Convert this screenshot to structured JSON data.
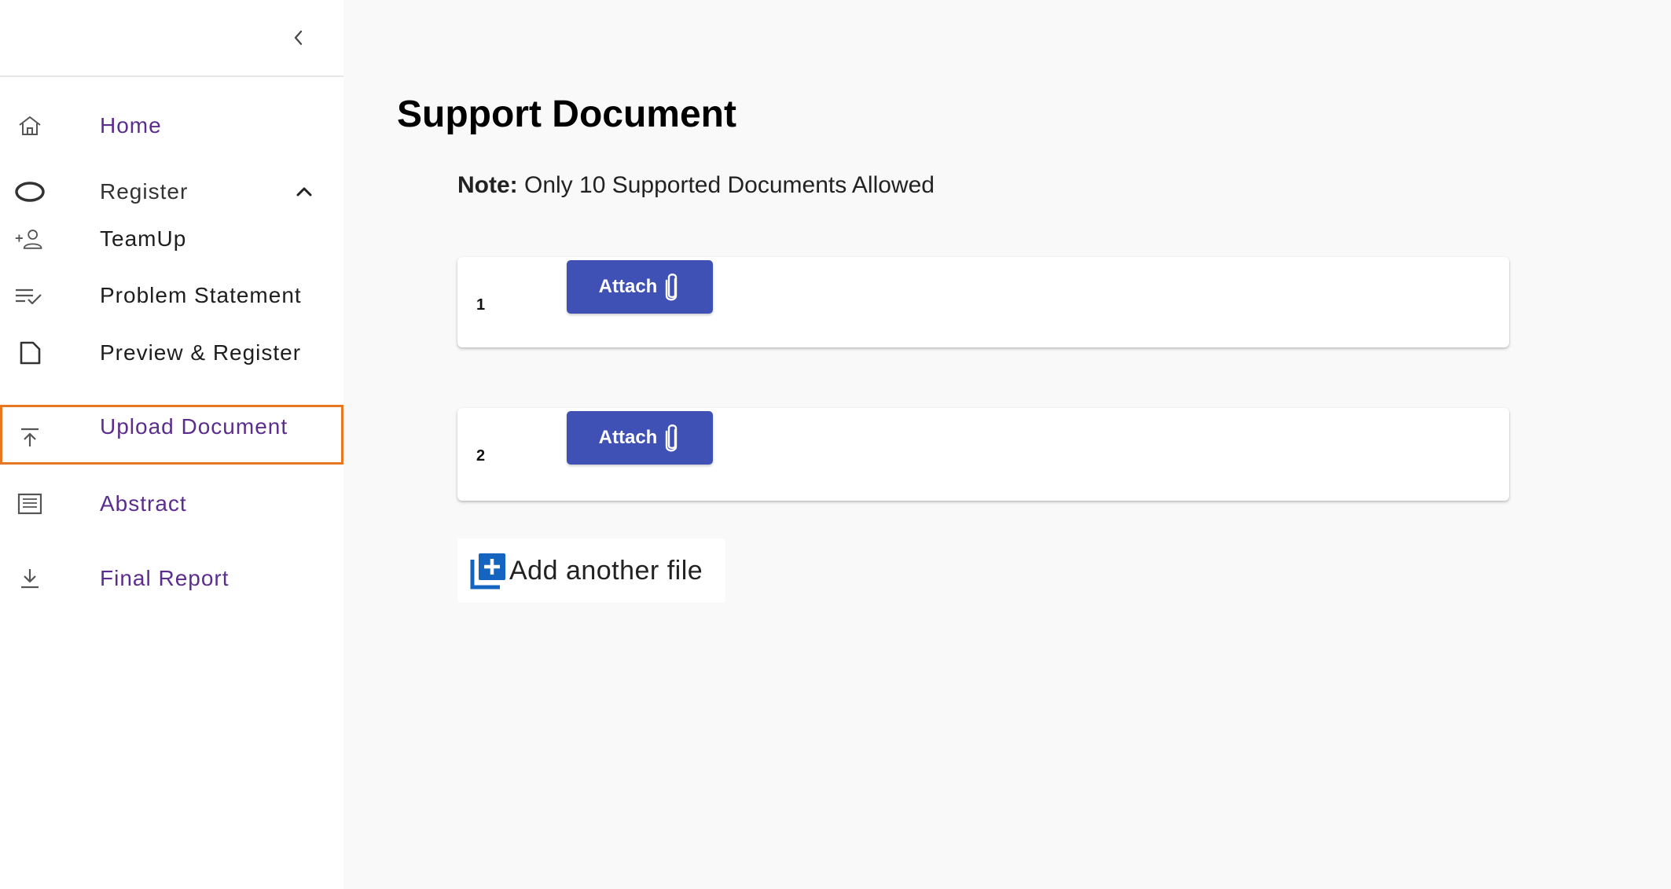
{
  "sidebar": {
    "collapse_icon": "chevron-left-icon",
    "items": [
      {
        "id": "home",
        "label": "Home",
        "icon": "home-icon"
      },
      {
        "id": "register",
        "label": "Register",
        "icon": "circle-icon",
        "expanded": true
      },
      {
        "id": "teamup",
        "label": "TeamUp",
        "icon": "add-person-icon"
      },
      {
        "id": "problem-statement",
        "label": "Problem Statement",
        "icon": "checklist-icon"
      },
      {
        "id": "preview-register",
        "label": "Preview & Register",
        "icon": "document-icon"
      },
      {
        "id": "upload-document",
        "label": "Upload Document",
        "icon": "upload-icon",
        "active": true
      },
      {
        "id": "abstract",
        "label": "Abstract",
        "icon": "list-box-icon"
      },
      {
        "id": "final-report",
        "label": "Final Report",
        "icon": "download-icon"
      }
    ]
  },
  "main": {
    "title": "Support Document",
    "note_prefix": "Note:",
    "note_text": " Only 10 Supported Documents Allowed",
    "documents": [
      {
        "number": "1",
        "attach_label": "Attach"
      },
      {
        "number": "2",
        "attach_label": "Attach"
      }
    ],
    "add_file_label": "Add another file"
  },
  "colors": {
    "accent": "#3f51b5",
    "active_outline": "#e87722",
    "nav_purple": "#5b2d8e",
    "background": "#f9f9f9"
  }
}
